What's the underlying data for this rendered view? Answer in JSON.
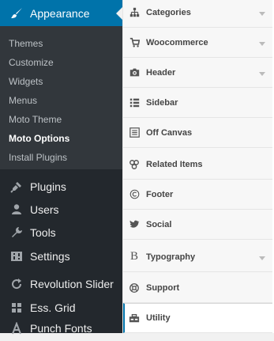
{
  "sidebar": {
    "current": {
      "label": "Appearance",
      "icon": "paintbrush-icon"
    },
    "submenu": [
      {
        "label": "Themes"
      },
      {
        "label": "Customize"
      },
      {
        "label": "Widgets"
      },
      {
        "label": "Menus"
      },
      {
        "label": "Moto Theme"
      },
      {
        "label": "Moto Options",
        "current": true
      },
      {
        "label": "Install Plugins"
      }
    ],
    "items": [
      {
        "label": "Plugins",
        "icon": "plugin-icon"
      },
      {
        "label": "Users",
        "icon": "user-icon"
      },
      {
        "label": "Tools",
        "icon": "wrench-icon"
      },
      {
        "label": "Settings",
        "icon": "settings-icon"
      },
      {
        "label": "Revolution Slider",
        "icon": "refresh-icon"
      },
      {
        "label": "Ess. Grid",
        "icon": "grid-icon"
      },
      {
        "label": "Punch Fonts",
        "icon": "font-icon"
      }
    ],
    "colors": {
      "background": "#23282d",
      "submenu": "#32373c",
      "accent": "#0073aa"
    }
  },
  "options": {
    "items": [
      {
        "label": "Categories",
        "icon": "sitemap-icon",
        "has_children": true
      },
      {
        "label": "Woocommerce",
        "icon": "cart-icon",
        "has_children": true
      },
      {
        "label": "Header",
        "icon": "camera-icon",
        "has_children": true
      },
      {
        "label": "Sidebar",
        "icon": "list-icon",
        "has_children": false
      },
      {
        "label": "Off Canvas",
        "icon": "menu-lines-icon",
        "has_children": false
      },
      {
        "label": "Related Items",
        "icon": "related-items-icon",
        "has_children": false
      },
      {
        "label": "Footer",
        "icon": "copyright-icon",
        "has_children": false
      },
      {
        "label": "Social",
        "icon": "twitter-icon",
        "has_children": false
      },
      {
        "label": "Typography",
        "icon": "typography-icon",
        "has_children": true
      },
      {
        "label": "Support",
        "icon": "lifebuoy-icon",
        "has_children": false
      },
      {
        "label": "Utility",
        "icon": "toolbox-icon",
        "has_children": false,
        "active": true
      }
    ]
  }
}
